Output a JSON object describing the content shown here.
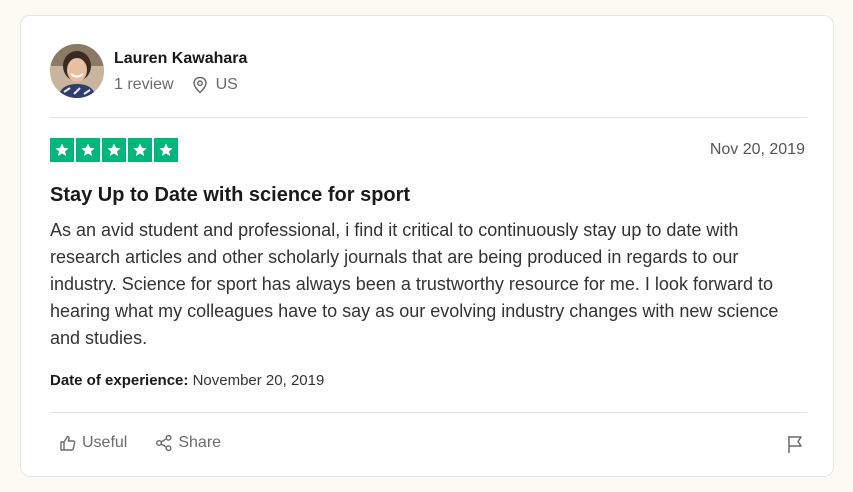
{
  "review": {
    "user": {
      "name": "Lauren Kawahara",
      "review_count": "1 review",
      "country": "US"
    },
    "rating": 5,
    "rating_color": "#00b67a",
    "date": "Nov 20, 2019",
    "title": "Stay Up to Date with science for sport",
    "body": "As an avid student and professional, i find it critical to continuously stay up to date with research articles and other scholarly journals that are being produced in regards to our industry. Science for sport has always been a trustworthy resource for me. I look forward to hearing what my colleagues have to say as our evolving industry changes with new science and studies.",
    "experience_label": "Date of experience:",
    "experience_date": "November 20, 2019"
  },
  "actions": {
    "useful_label": "Useful",
    "share_label": "Share"
  },
  "icons": {
    "avatar": "avatar-photo",
    "location": "location-pin-icon",
    "star": "star-icon",
    "useful": "thumbs-up-icon",
    "share": "share-icon",
    "flag": "flag-icon"
  }
}
